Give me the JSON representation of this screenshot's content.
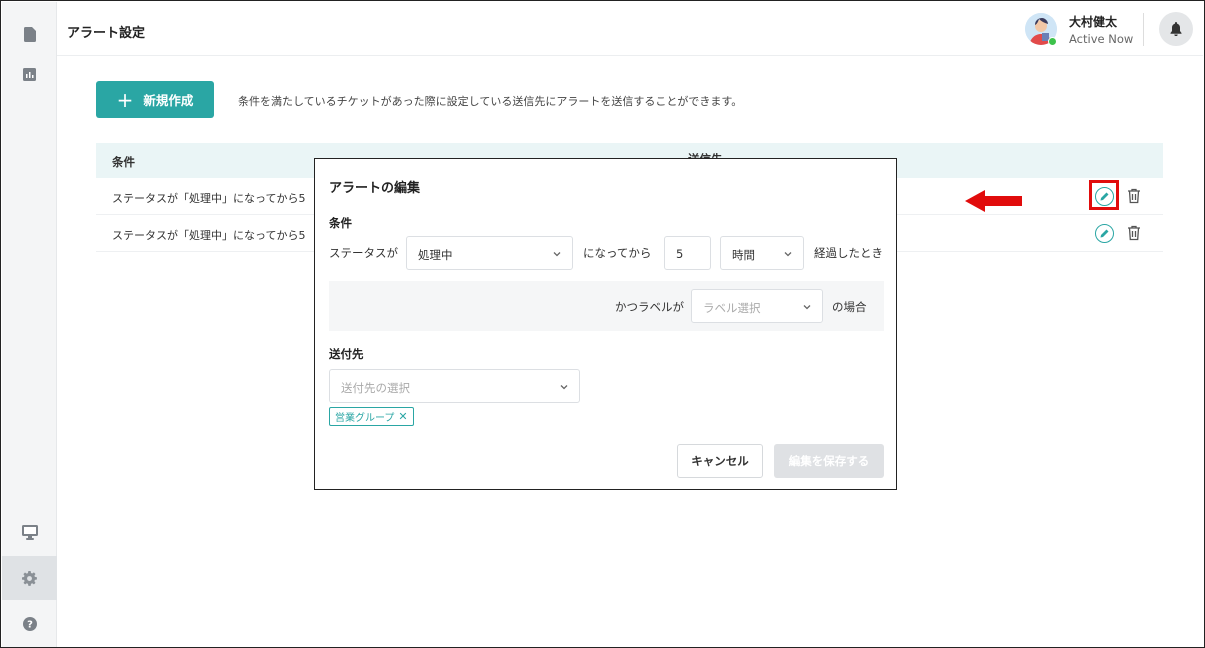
{
  "sidebar": {
    "items": [
      {
        "icon": "document-icon"
      },
      {
        "icon": "bar-chart-icon"
      },
      {
        "icon": "monitor-icon"
      },
      {
        "icon": "gear-icon",
        "active": true
      },
      {
        "icon": "help-icon"
      }
    ]
  },
  "header": {
    "title": "アラート設定",
    "user_name": "大村健太",
    "user_status": "Active Now"
  },
  "main": {
    "new_button_label": "新規作成",
    "description": "条件を満たしているチケットがあった際に設定している送信先にアラートを送信することができます。",
    "table": {
      "columns": [
        "条件",
        "送信先"
      ],
      "rows": [
        {
          "condition": "ステータスが「処理中」になってから5"
        },
        {
          "condition": "ステータスが「処理中」になってから5"
        }
      ]
    }
  },
  "modal": {
    "title": "アラートの編集",
    "condition_label": "条件",
    "status_prefix": "ステータスが",
    "status_value": "処理中",
    "after_text": "になってから",
    "duration_value": "5",
    "unit_value": "時間",
    "elapsed_text": "経過したとき",
    "label_prefix": "かつラベルが",
    "label_placeholder": "ラベル選択",
    "label_suffix": "の場合",
    "destination_label": "送付先",
    "destination_placeholder": "送付先の選択",
    "selected_tag": "営業グループ",
    "cancel_label": "キャンセル",
    "save_label": "編集を保存する"
  },
  "colors": {
    "accent": "#2aa6a4",
    "highlight": "#e10c0c",
    "table_header_bg": "#eaf5f6"
  }
}
